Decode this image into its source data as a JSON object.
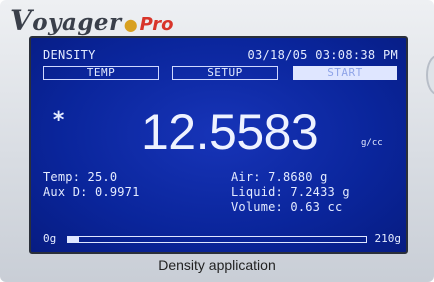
{
  "brand": {
    "name": "Voyager",
    "name_initial": "V",
    "name_rest": "oyager",
    "suffix": "Pro",
    "suffix_color": "#d8342a"
  },
  "status": {
    "mode": "DENSITY",
    "date": "03/18/05",
    "time": "03:08:38 PM"
  },
  "softkeys": [
    {
      "label": "TEMP",
      "selected": false
    },
    {
      "label": "SETUP",
      "selected": false
    },
    {
      "label": "START",
      "selected": true
    }
  ],
  "reading": {
    "stability_mark": "*",
    "value": "12.5583",
    "unit": "g/cc"
  },
  "details_left": {
    "temp": "Temp: 25.0",
    "aux": "Aux D: 0.9971"
  },
  "details_right": {
    "air": "Air: 7.8680 g",
    "liquid": "Liquid: 7.2433 g",
    "volume": "Volume: 0.63 cc"
  },
  "capacity_bar": {
    "min_label": "0g",
    "max_label": "210g",
    "fill_fraction": 0.037
  },
  "caption": "Density application",
  "colors": {
    "screen": "#0a259b",
    "screen_text": "#dfe6ff"
  }
}
